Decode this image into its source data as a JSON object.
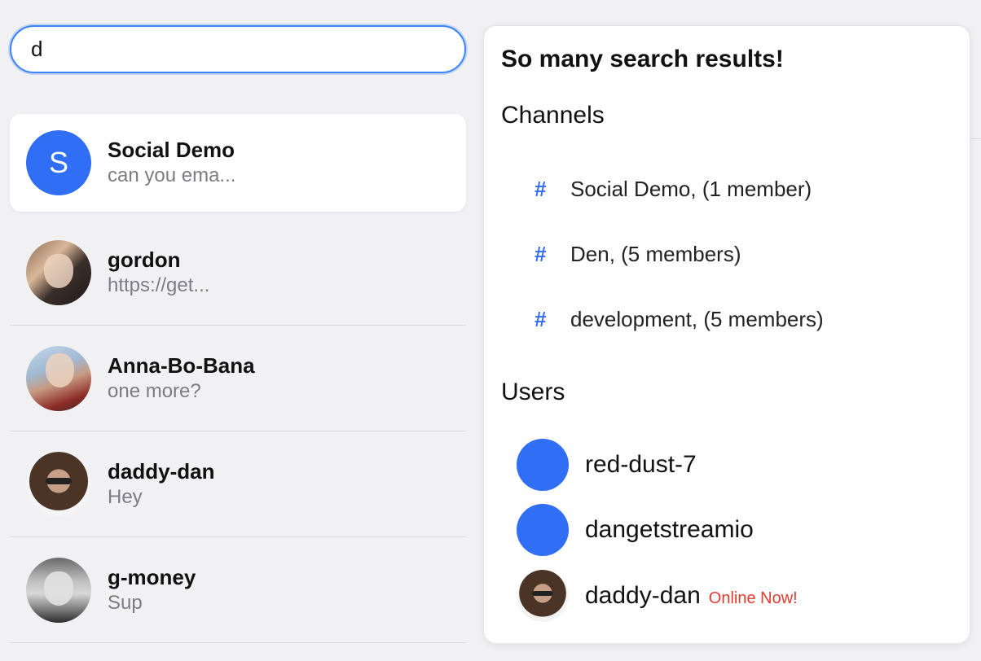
{
  "search": {
    "value": "d",
    "placeholder": ""
  },
  "conversations": [
    {
      "name": "Social Demo",
      "preview": "can you ema...",
      "avatar_letter": "S",
      "active": true
    },
    {
      "name": "gordon",
      "preview": "https://get..."
    },
    {
      "name": "Anna-Bo-Bana",
      "preview": "one more?"
    },
    {
      "name": "daddy-dan",
      "preview": "Hey"
    },
    {
      "name": "g-money",
      "preview": "Sup"
    }
  ],
  "results": {
    "title": "So many search results!",
    "channels_label": "Channels",
    "channels": [
      {
        "label": "Social Demo, (1 member)"
      },
      {
        "label": "Den, (5 members)"
      },
      {
        "label": "development, (5 members)"
      }
    ],
    "users_label": "Users",
    "users": [
      {
        "name": "red-dust-7",
        "status": ""
      },
      {
        "name": "dangetstreamio",
        "status": ""
      },
      {
        "name": "daddy-dan",
        "status": "Online Now!"
      }
    ]
  },
  "colors": {
    "accent": "#2f6ef5",
    "online": "#e23b2f",
    "background": "#f1f1f4"
  },
  "icons": {
    "channel": "hash-icon"
  },
  "hash_glyph": "#"
}
